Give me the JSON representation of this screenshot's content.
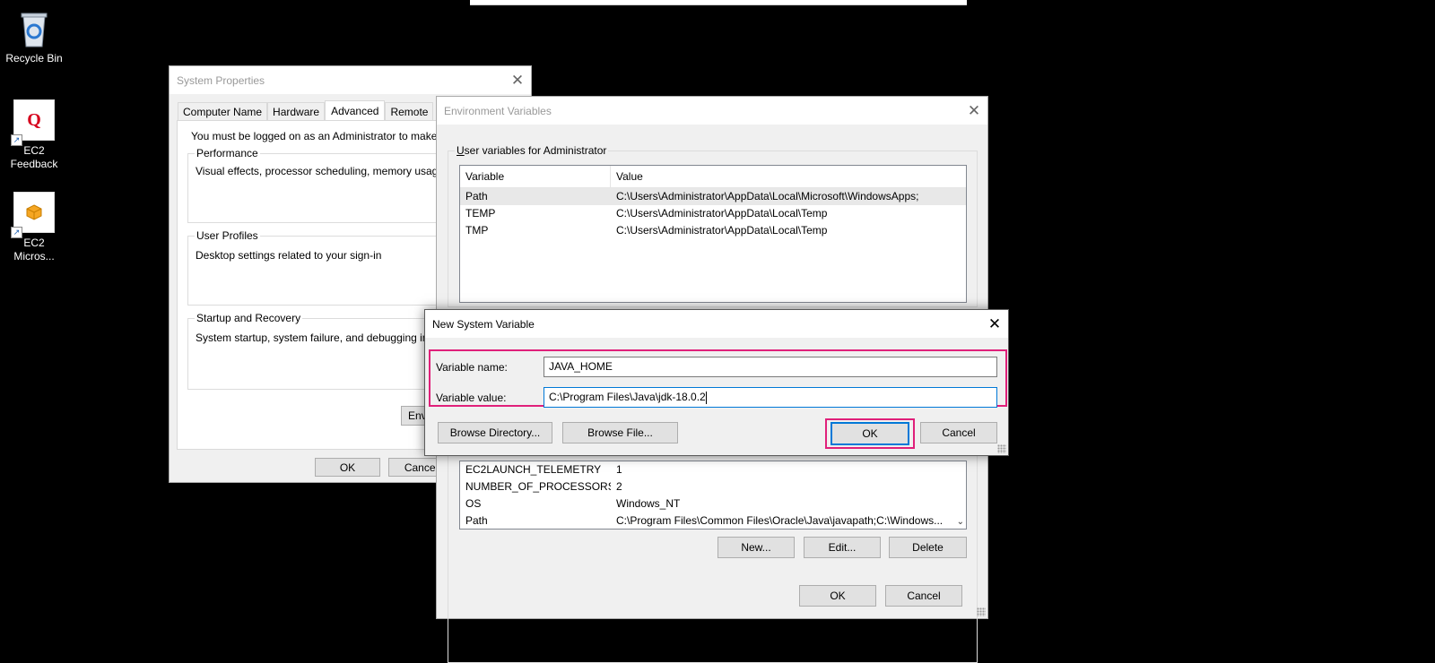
{
  "desktop": {
    "icons": [
      {
        "label": "Recycle Bin"
      },
      {
        "label_line1": "EC2",
        "label_line2": "Feedback"
      },
      {
        "label_line1": "EC2",
        "label_line2": "Micros..."
      }
    ]
  },
  "system_properties": {
    "title": "System Properties",
    "tabs": [
      "Computer Name",
      "Hardware",
      "Advanced",
      "Remote"
    ],
    "admin_note": "You must be logged on as an Administrator to make most c",
    "performance": {
      "label": "Performance",
      "text": "Visual effects, processor scheduling, memory usage, and"
    },
    "user_profiles": {
      "label": "User Profiles",
      "text": "Desktop settings related to your sign-in"
    },
    "startup": {
      "label": "Startup and Recovery",
      "text": "System startup, system failure, and debugging informat"
    },
    "env_button": "Envi",
    "ok": "OK",
    "cancel": "Cancel"
  },
  "env_vars": {
    "title": "Environment Variables",
    "user_group_label": "User variables for Administrator",
    "columns": {
      "variable": "Variable",
      "value": "Value"
    },
    "user_rows": [
      {
        "variable": "Path",
        "value": "C:\\Users\\Administrator\\AppData\\Local\\Microsoft\\WindowsApps;"
      },
      {
        "variable": "TEMP",
        "value": "C:\\Users\\Administrator\\AppData\\Local\\Temp"
      },
      {
        "variable": "TMP",
        "value": "C:\\Users\\Administrator\\AppData\\Local\\Temp"
      }
    ],
    "system_rows": [
      {
        "variable": "EC2LAUNCH_TELEMETRY",
        "value": "1"
      },
      {
        "variable": "NUMBER_OF_PROCESSORS",
        "value": "2"
      },
      {
        "variable": "OS",
        "value": "Windows_NT"
      },
      {
        "variable": "Path",
        "value": "C:\\Program Files\\Common Files\\Oracle\\Java\\javapath;C:\\Windows..."
      }
    ],
    "new_btn": "New...",
    "edit_btn": "Edit...",
    "delete_btn": "Delete",
    "ok": "OK",
    "cancel": "Cancel"
  },
  "new_system_variable": {
    "title": "New System Variable",
    "name_label": "Variable name:",
    "value_label": "Variable value:",
    "name_value": "JAVA_HOME",
    "value_value": "C:\\Program Files\\Java\\jdk-18.0.2",
    "browse_directory": "Browse Directory...",
    "browse_file": "Browse File...",
    "ok": "OK",
    "cancel": "Cancel"
  },
  "colors": {
    "highlight": "#e0207a",
    "focus": "#0078d7"
  }
}
